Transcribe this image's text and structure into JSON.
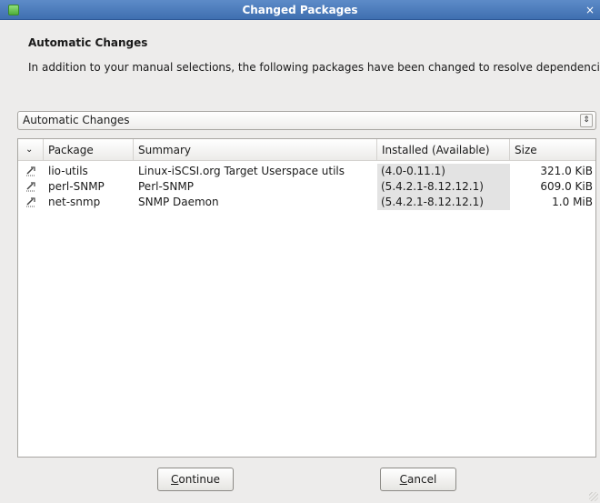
{
  "window": {
    "title": "Changed Packages",
    "app_icon": "green-square-icon",
    "close_glyph": "×"
  },
  "heading": "Automatic Changes",
  "description": "In addition to your manual selections, the following packages have been changed to resolve dependencies:",
  "combo": {
    "selected": "Automatic Changes",
    "arrow_glyph": "⇕"
  },
  "table": {
    "sort_glyph": "⌄",
    "columns": [
      "Package",
      "Summary",
      "Installed (Available)",
      "Size"
    ],
    "rows": [
      {
        "icon": "update-package-icon",
        "package": "lio-utils",
        "summary": "Linux-iSCSI.org Target Userspace utils",
        "installed": "(4.0-0.11.1)",
        "size": "321.0 KiB"
      },
      {
        "icon": "update-package-icon",
        "package": "perl-SNMP",
        "summary": "Perl-SNMP",
        "installed": "(5.4.2.1-8.12.12.1)",
        "size": "609.0 KiB"
      },
      {
        "icon": "update-package-icon",
        "package": "net-snmp",
        "summary": "SNMP Daemon",
        "installed": "(5.4.2.1-8.12.12.1)",
        "size": "1.0 MiB"
      }
    ]
  },
  "buttons": {
    "continue_label": "Continue",
    "cancel_label": "Cancel"
  }
}
